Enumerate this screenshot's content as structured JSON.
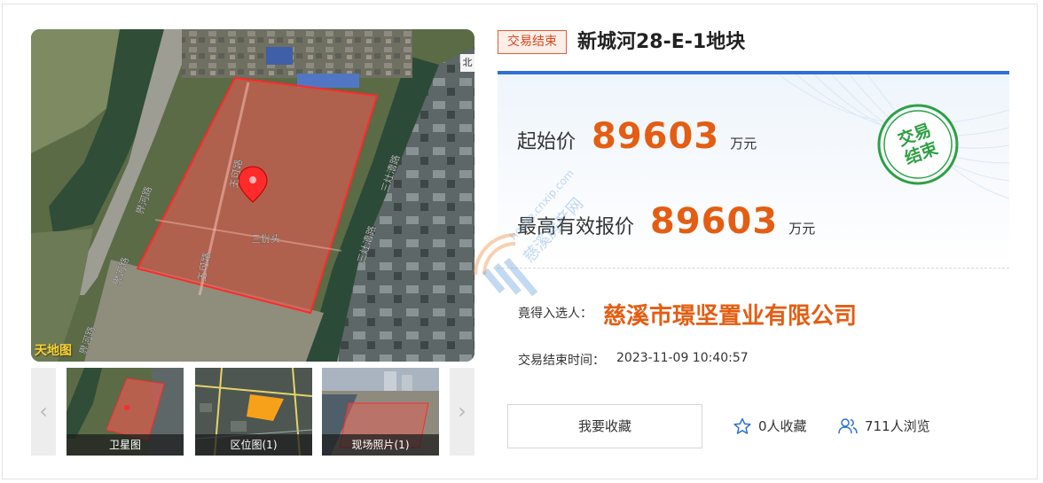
{
  "listing": {
    "status_tag": "交易结束",
    "title": "新城河28-E-1地块"
  },
  "gallery": {
    "compass_label": "北",
    "brand_logo": "天地图",
    "site_label": "三份头",
    "road_labels": {
      "left_top": "界河路",
      "left_bottom": "界河路",
      "left_corner": "界河路",
      "wangke_top": "王可路",
      "wangke_bottom": "王可路",
      "right_top": "三灶漕路",
      "right_bottom": "三灶漕路"
    },
    "thumbnails": [
      {
        "label": "卫星图"
      },
      {
        "label": "区位图(1)"
      },
      {
        "label": "现场照片(1)"
      }
    ],
    "prev_arrow": "‹",
    "next_arrow": "›"
  },
  "pricing": {
    "start_label": "起始价",
    "start_value": "89603",
    "start_unit": "万元",
    "top_label": "最高有效报价",
    "top_value": "89603",
    "top_unit": "万元"
  },
  "stamp": {
    "line1": "交易",
    "line2": "结束",
    "color": "#2ea043"
  },
  "result": {
    "winner_label": "竟得入选人：",
    "winner_name": "慈溪市璟坚置业有限公司",
    "end_time_label": "交易结束时间：",
    "end_time_value": "2023-11-09 10:40:57"
  },
  "actions": {
    "favorite_button": "我要收藏",
    "favorites_count": "0人收藏",
    "views_count": "711人浏览"
  },
  "watermark": {
    "domain": "house.cnxip.com",
    "text": "慈溪房产网"
  },
  "colors": {
    "accent_blue": "#2f6fd6",
    "price_orange": "#e45d12",
    "tag_red": "#d9481e"
  }
}
